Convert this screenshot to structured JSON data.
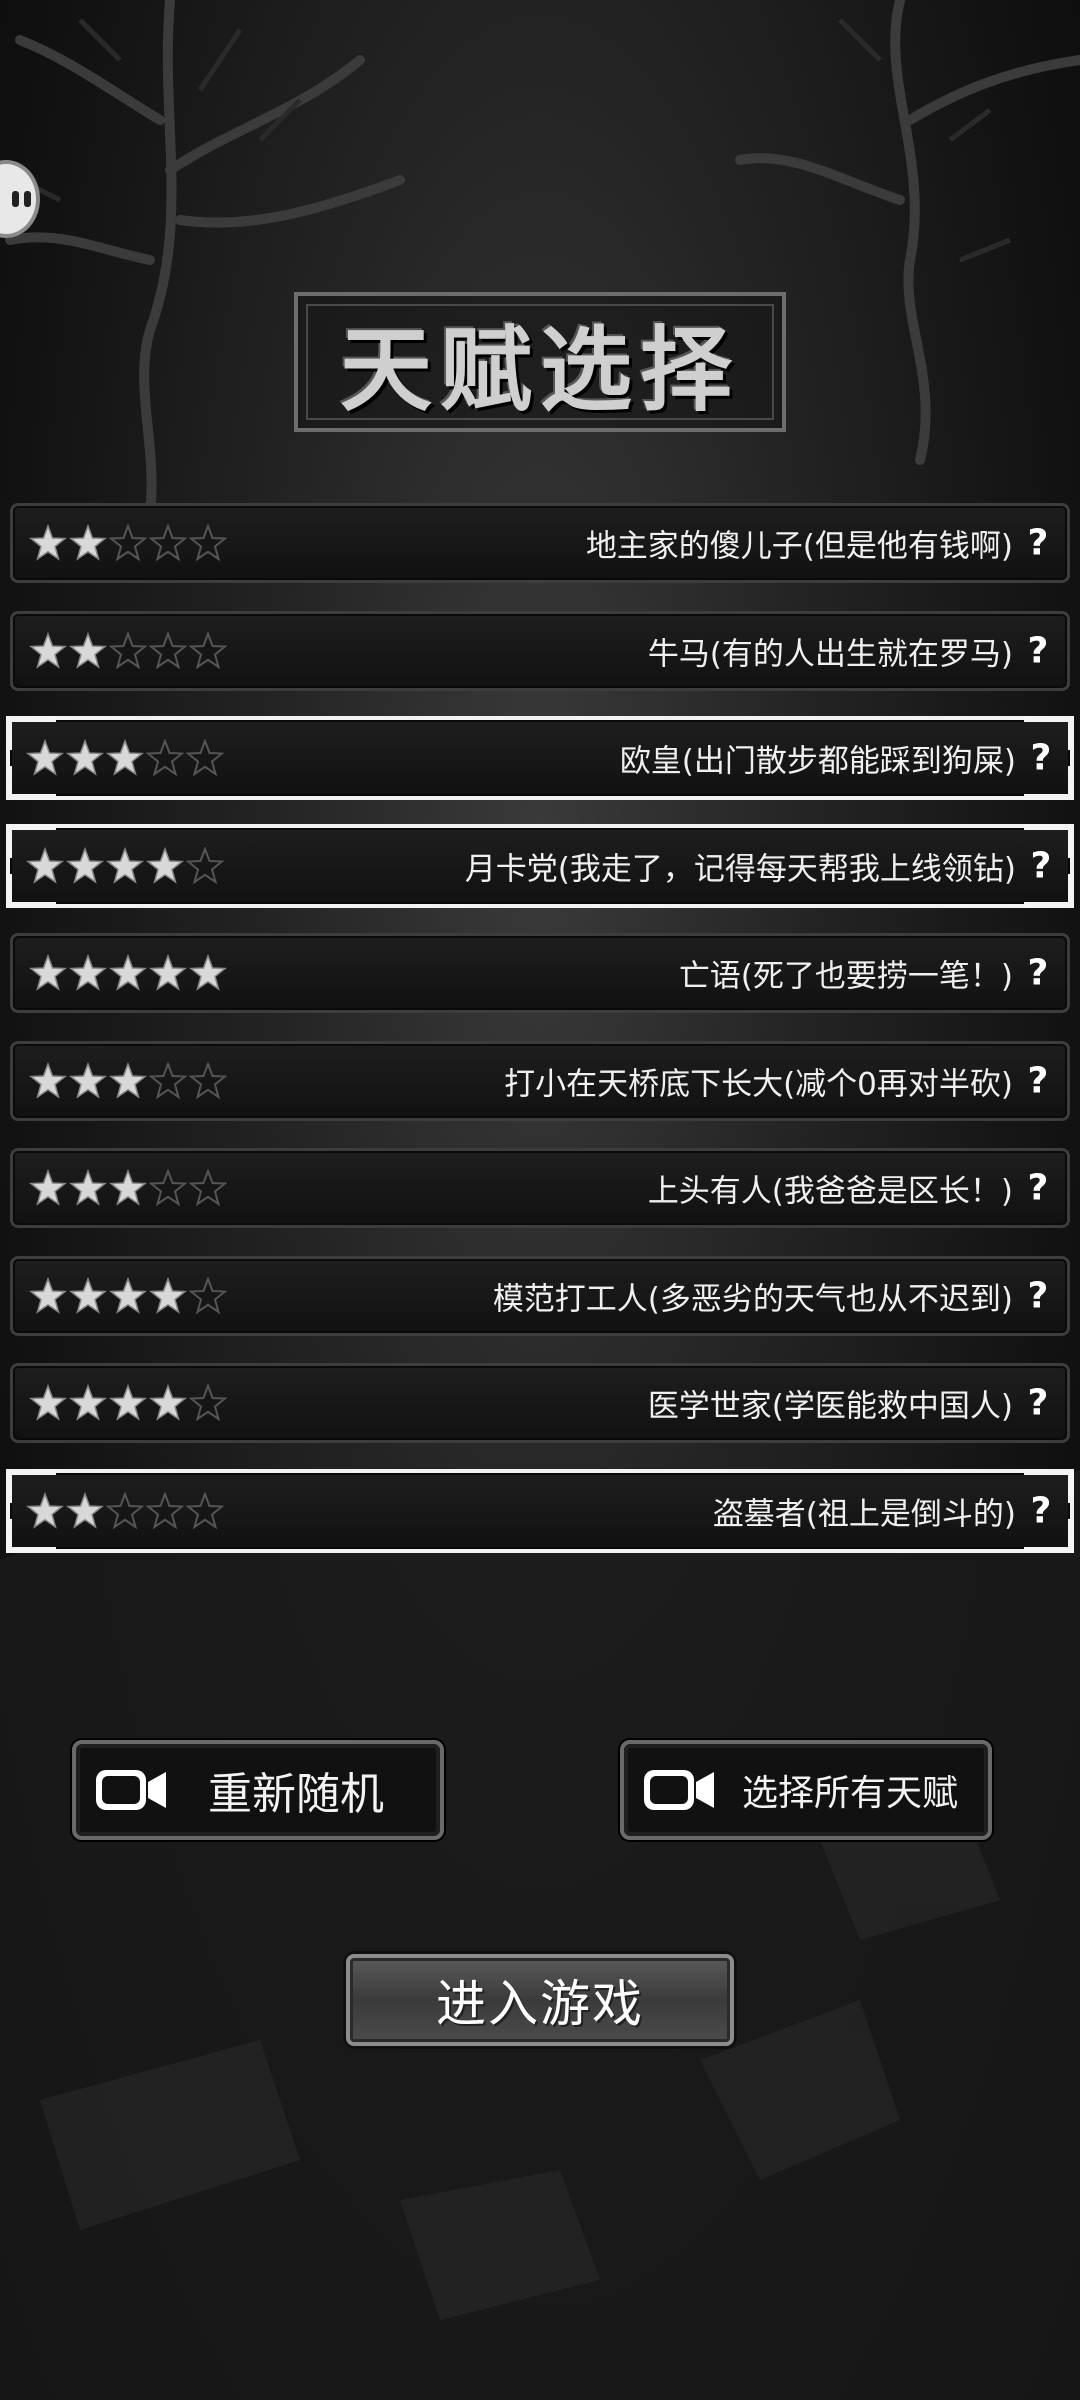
{
  "title": "天赋选择",
  "colors": {
    "background": "#0c0c0c",
    "row_border": "#3d3d3d",
    "selected_border": "#f2f2f2",
    "star_filled": "#d8d8d8",
    "star_empty": "#555555",
    "text": "#f0f0f0"
  },
  "talents": [
    {
      "name": "地主家的傻儿子(但是他有钱啊)",
      "stars": 2,
      "max_stars": 5,
      "selected": false,
      "help": "?"
    },
    {
      "name": "牛马(有的人出生就在罗马)",
      "stars": 2,
      "max_stars": 5,
      "selected": false,
      "help": "?"
    },
    {
      "name": "欧皇(出门散步都能踩到狗屎)",
      "stars": 3,
      "max_stars": 5,
      "selected": true,
      "help": "?"
    },
    {
      "name": "月卡党(我走了，记得每天帮我上线领钻)",
      "stars": 4,
      "max_stars": 5,
      "selected": true,
      "help": "?"
    },
    {
      "name": "亡语(死了也要捞一笔！)",
      "stars": 5,
      "max_stars": 5,
      "selected": false,
      "help": "?"
    },
    {
      "name": "打小在天桥底下长大(减个0再对半砍)",
      "stars": 3,
      "max_stars": 5,
      "selected": false,
      "help": "?"
    },
    {
      "name": "上头有人(我爸爸是区长！)",
      "stars": 3,
      "max_stars": 5,
      "selected": false,
      "help": "?"
    },
    {
      "name": "模范打工人(多恶劣的天气也从不迟到)",
      "stars": 4,
      "max_stars": 5,
      "selected": false,
      "help": "?"
    },
    {
      "name": "医学世家(学医能救中国人)",
      "stars": 4,
      "max_stars": 5,
      "selected": false,
      "help": "?"
    },
    {
      "name": "盗墓者(祖上是倒斗的)",
      "stars": 2,
      "max_stars": 5,
      "selected": true,
      "help": "?"
    }
  ],
  "buttons": {
    "rerandom": "重新随机",
    "select_all": "选择所有天赋",
    "enter": "进入游戏"
  },
  "icons": {
    "side_handle": "floating-assistant-icon",
    "video": "video-camera-icon",
    "star": "star-icon",
    "help": "question-mark-icon"
  }
}
